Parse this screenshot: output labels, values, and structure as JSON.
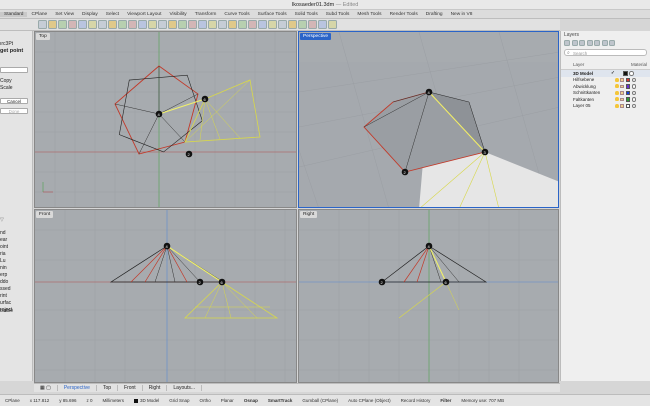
{
  "window": {
    "title": "Ikosaeder01.3dm",
    "status": "— Edited"
  },
  "menu": [
    "Standard",
    "CPlane",
    "Set View",
    "Display",
    "Select",
    "Viewport Layout",
    "Visibility",
    "Transform",
    "Curve Tools",
    "Surface Tools",
    "Solid Tools",
    "Subd Tools",
    "Mesh Tools",
    "Render Tools",
    "Drafting",
    "New in V8"
  ],
  "command": {
    "line1": "ırc3Pt",
    "line2": "get point",
    "opt1": "Copy",
    "opt2": "Scale",
    "cancel": "Cancel",
    "done": "Done",
    "hist": [
      "nd",
      "ear",
      "oint",
      "ria",
      "Lu",
      "nin",
      "erp",
      "ddo",
      "ssed",
      "rint",
      "urfac",
      "roject"
    ],
    "extra": "isable"
  },
  "viewports": {
    "top": "Top",
    "perspective": "Perspective",
    "front": "Front",
    "right": "Right"
  },
  "layers": {
    "title": "Layers",
    "search": "Search",
    "col_layer": "Layer",
    "col_material": "Material",
    "rows": [
      {
        "name": "3D Model",
        "color": "#111111",
        "current": true
      },
      {
        "name": "Hilfsebene",
        "color": "#e03030",
        "current": false
      },
      {
        "name": "Abwicklung",
        "color": "#6a2fd0",
        "current": false
      },
      {
        "name": "Schnittkanten",
        "color": "#1a3ee0",
        "current": false
      },
      {
        "name": "Faltkanten",
        "color": "#2fa02f",
        "current": false
      },
      {
        "name": "Layer 05",
        "color": "#ffffff",
        "current": false
      }
    ]
  },
  "viewport_tabs": [
    "Perspective",
    "Top",
    "Front",
    "Right",
    "Layouts..."
  ],
  "status": {
    "cplane": "CPlane",
    "x": "x 117.812",
    "y": "y 85.696",
    "z": "z 0",
    "units": "Millimeters",
    "layer": "3D Model",
    "items": [
      "Grid Snap",
      "Ortho",
      "Planar",
      "Osnap",
      "SmartTrack",
      "Gumball (CPlane)",
      "Auto CPlane (Object)",
      "Record History",
      "Filter",
      "Memory use: 707 MB"
    ]
  },
  "colors": {
    "accent": "#2a64c8",
    "viewport_bg": "#a7abaf"
  }
}
